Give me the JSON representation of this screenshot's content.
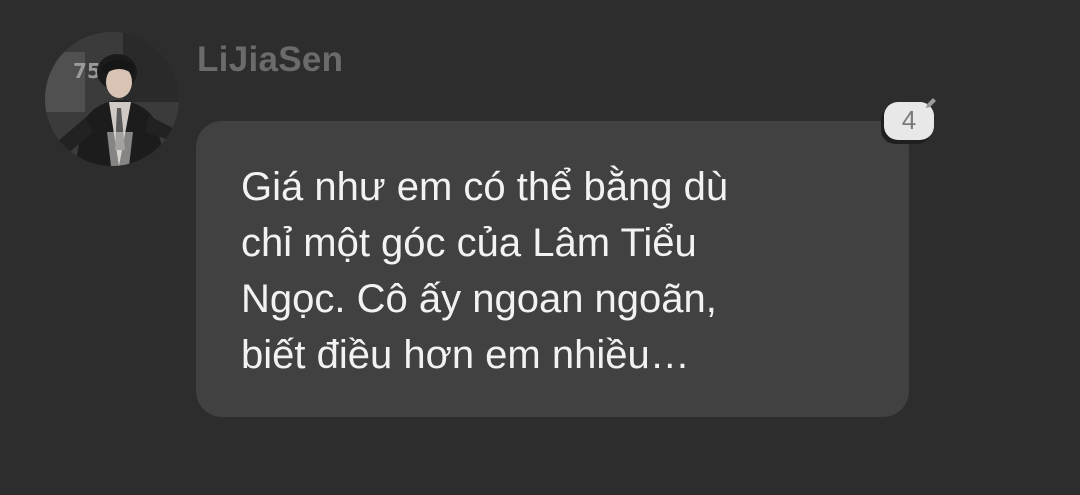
{
  "message": {
    "sender": "LiJiaSen",
    "avatar_icon": "profile-photo",
    "text_lines": [
      "Giá như em có thể bằng dù",
      "chỉ một góc của Lâm Tiểu",
      "Ngọc. Cô ấy ngoan ngoãn,",
      "biết điều hơn em nhiều…"
    ],
    "reaction_count": "4",
    "reaction_icon": "pencil-icon"
  },
  "colors": {
    "background": "#2d2d2d",
    "bubble": "#414141",
    "sender_name": "#6b6b6b",
    "message_text": "#f2f2f2",
    "badge": "#e8e8e8"
  }
}
